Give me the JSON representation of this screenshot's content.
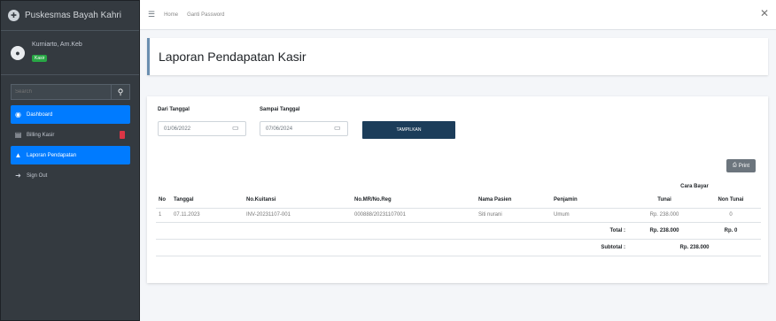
{
  "brand": {
    "name": "Puskesmas Bayah Kahri"
  },
  "user": {
    "name": "Kurniarto, Am.Keb",
    "badge": "Kasir"
  },
  "search": {
    "placeholder": "Search"
  },
  "sidebar": {
    "items": [
      {
        "label": "Dashboard",
        "icon": "dashboard-icon",
        "active": true
      },
      {
        "label": "Billing Kasir",
        "icon": "billing-icon",
        "active": false
      },
      {
        "label": "Laporan Pendapatan",
        "icon": "report-icon",
        "active": true
      },
      {
        "label": "Sign Out",
        "icon": "sign-out-icon",
        "active": false
      }
    ]
  },
  "navbar": {
    "home": "Home",
    "change_password": "Ganti Password"
  },
  "page": {
    "title": "Laporan Pendapatan Kasir"
  },
  "filter": {
    "from_label": "Dari Tanggal",
    "from_value": "01/06/2022",
    "to_label": "Sampai Tanggal",
    "to_value": "07/06/2024",
    "show_button": "TAMPILKAN",
    "print_button": "Print"
  },
  "table": {
    "group_header": "Cara Bayar",
    "headers": [
      "No",
      "Tanggal",
      "No.Kuitansi",
      "No.MR/No.Reg",
      "Nama Pasien",
      "Penjamin",
      "Tunai",
      "Non Tunai"
    ],
    "rows": [
      [
        "1",
        "07.11.2023",
        "INV-20231107-001",
        "000888/20231107001",
        "Siti nurani",
        "Umum",
        "Rp. 238.000",
        "0"
      ]
    ],
    "total_label": "Total :",
    "total_tunai": "Rp. 238.000",
    "total_non_tunai": "Rp. 0",
    "subtotal_label": "Subtotal :",
    "subtotal_value": "Rp. 238.000"
  },
  "colors": {
    "sidebar_bg": "#343a40",
    "active_nav": "#007bff",
    "show_button": "#1c3d5a",
    "print_button": "#6c757d"
  }
}
